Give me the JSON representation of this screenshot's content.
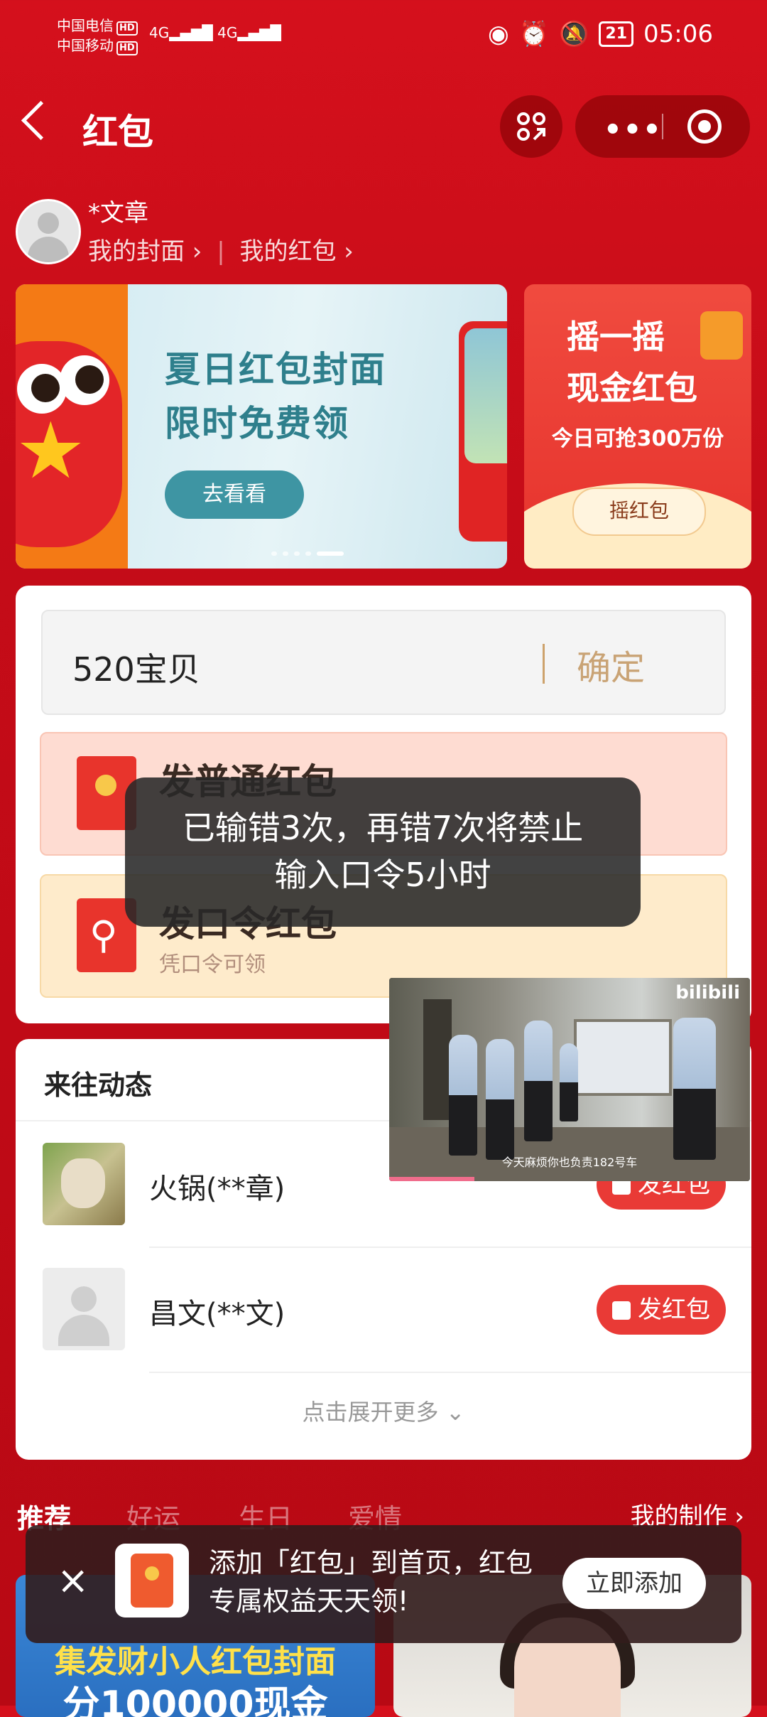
{
  "status_bar": {
    "carrier1": "中国电信",
    "carrier2": "中国移动",
    "hd": "HD",
    "network": "4G",
    "battery": "21",
    "time": "05:06"
  },
  "header": {
    "title": "红包"
  },
  "user": {
    "name": "*文章",
    "link_covers": "我的封面",
    "link_packets": "我的红包"
  },
  "banner_main": {
    "line1": "夏日红包封面",
    "line2": "限时免费领",
    "button": "去看看"
  },
  "banner_side": {
    "line1": "摇一摇",
    "line2": "现金红包",
    "line3": "今日可抢300万份",
    "button": "摇红包"
  },
  "password_input": {
    "value": "520宝贝",
    "confirm": "确定"
  },
  "options": [
    {
      "title": "发普通红包",
      "subtitle": ""
    },
    {
      "title": "发口令红包",
      "subtitle": "凭口令可领"
    }
  ],
  "toast": {
    "line1": "已输错3次，再错7次将禁止",
    "line2": "输入口令5小时"
  },
  "activity": {
    "title": "来往动态",
    "rows": [
      {
        "name": "火锅(**章)",
        "button": "发红包"
      },
      {
        "name": "昌文(**文)",
        "button": "发红包"
      }
    ],
    "more": "点击展开更多"
  },
  "video": {
    "watermark": "bilibili",
    "subtitle": "今天麻烦你也负责182号车"
  },
  "tabs": [
    "推荐",
    "好运",
    "生日",
    "爱情"
  ],
  "my_creations": "我的制作",
  "bottom_cards": {
    "card1_line1": "集发财小人红包封面",
    "card1_line2": "分100000现金"
  },
  "add_banner": {
    "message": "添加「红包」到首页，红包专属权益天天领!",
    "button": "立即添加"
  }
}
